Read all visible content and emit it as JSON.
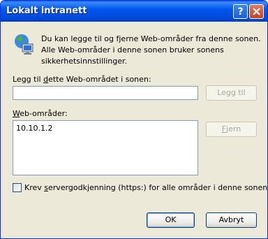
{
  "window": {
    "title": "Lokalt intranett"
  },
  "icons": {
    "help": "help-icon",
    "close": "close-icon",
    "zone": "intranet-zone-icon"
  },
  "description": "Du kan legge til og fjerne Web-områder fra denne sonen. Alle Web-områder i denne sonen bruker sonens sikkerhetsinnstillinger.",
  "add_field": {
    "label_prefix": "Legg til ",
    "label_accel": "d",
    "label_rest": "ette Web-området i sonen:",
    "value": ""
  },
  "add_button": {
    "label": "Legg til"
  },
  "sites": {
    "label_accel": "W",
    "label_rest": "eb-områder:",
    "items": [
      "10.10.1.2"
    ]
  },
  "remove_button": {
    "label_accel": "F",
    "label_rest": "jern"
  },
  "require_https": {
    "checked": false,
    "label_pre": "Krev ",
    "label_accel": "s",
    "label_rest": "ervergodkjenning (https:) for alle områder i denne sonen."
  },
  "ok_button": {
    "label": "OK"
  },
  "cancel_button": {
    "label": "Avbryt"
  }
}
